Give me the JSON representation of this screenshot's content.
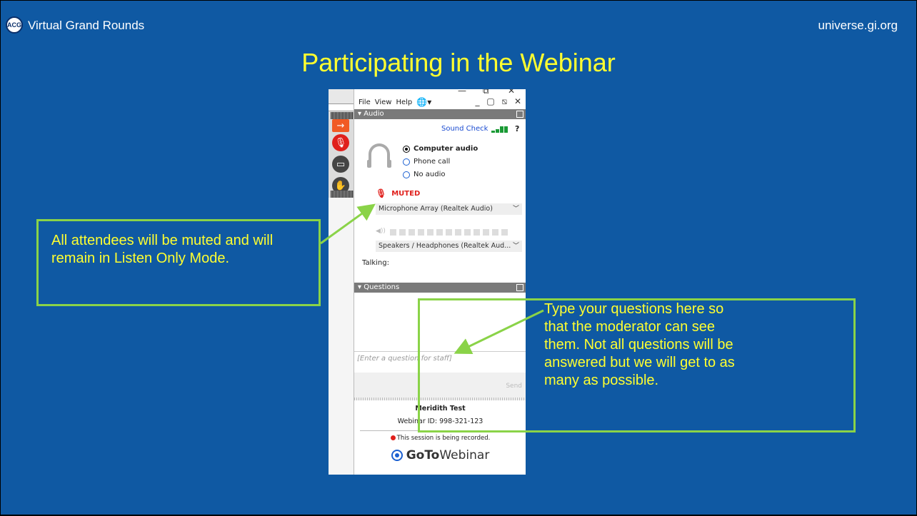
{
  "header": {
    "logo_text": "ACG",
    "title": "Virtual Grand Rounds",
    "url": "universe.gi.org"
  },
  "slide_title": "Participating in the Webinar",
  "gotowebinar": {
    "menu": [
      "File",
      "View",
      "Help"
    ],
    "window_controls": "_ ▢ ⧅ ✕",
    "audio_section": {
      "title": "Audio",
      "sound_check": "Sound Check",
      "help": "?",
      "options": [
        "Computer audio",
        "Phone call",
        "No audio"
      ],
      "selected": "Computer audio",
      "status": "MUTED",
      "microphone": "Microphone Array (Realtek Audio)",
      "speakers": "Speakers / Headphones (Realtek Aud...",
      "talking": "Talking:"
    },
    "questions_section": {
      "title": "Questions",
      "input_placeholder": "[Enter a question for staff]",
      "send": "Send"
    },
    "organizer_name": "Meridith Test",
    "webinar_id": "Webinar ID: 998-321-123",
    "recording_notice": "This session is being recorded.",
    "brand_bold": "GoTo",
    "brand_rest": "Webinar"
  },
  "callouts": {
    "left": "All attendees will be muted and will remain in Listen Only Mode.",
    "right": "Type your questions here so that the moderator can see them. Not all questions will be answered but we will get to as many as possible."
  },
  "colors": {
    "background": "#0f59a3",
    "title_yellow": "#ffff30",
    "callout_green": "#8ad348",
    "muted_red": "#e0201c"
  }
}
